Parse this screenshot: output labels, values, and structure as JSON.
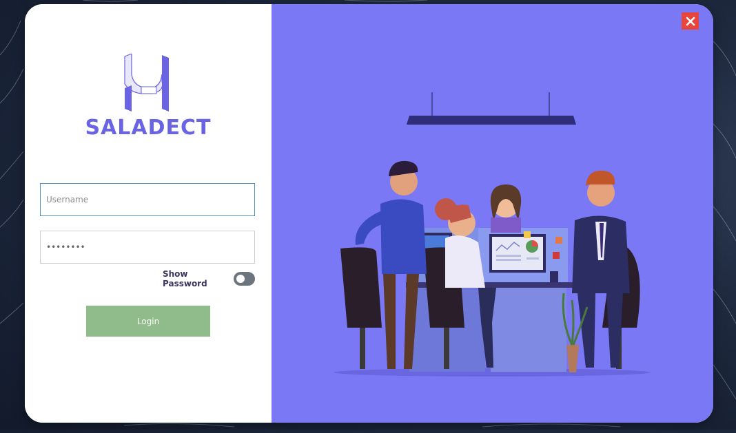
{
  "app": {
    "brand_name": "SALADECT",
    "logo_icon": "saladect-h-logo-icon"
  },
  "login": {
    "username_placeholder": "Username",
    "password_value": "********",
    "show_password_label": "Show Password",
    "show_password_on": false,
    "login_label": "Login"
  },
  "window": {
    "close_icon": "close-icon"
  },
  "colors": {
    "brand": "#6a63e3",
    "panel": "#7b78f5",
    "login_button": "#8fbc8a",
    "close_button": "#e8453c",
    "toggle_off": "#6c757d"
  }
}
